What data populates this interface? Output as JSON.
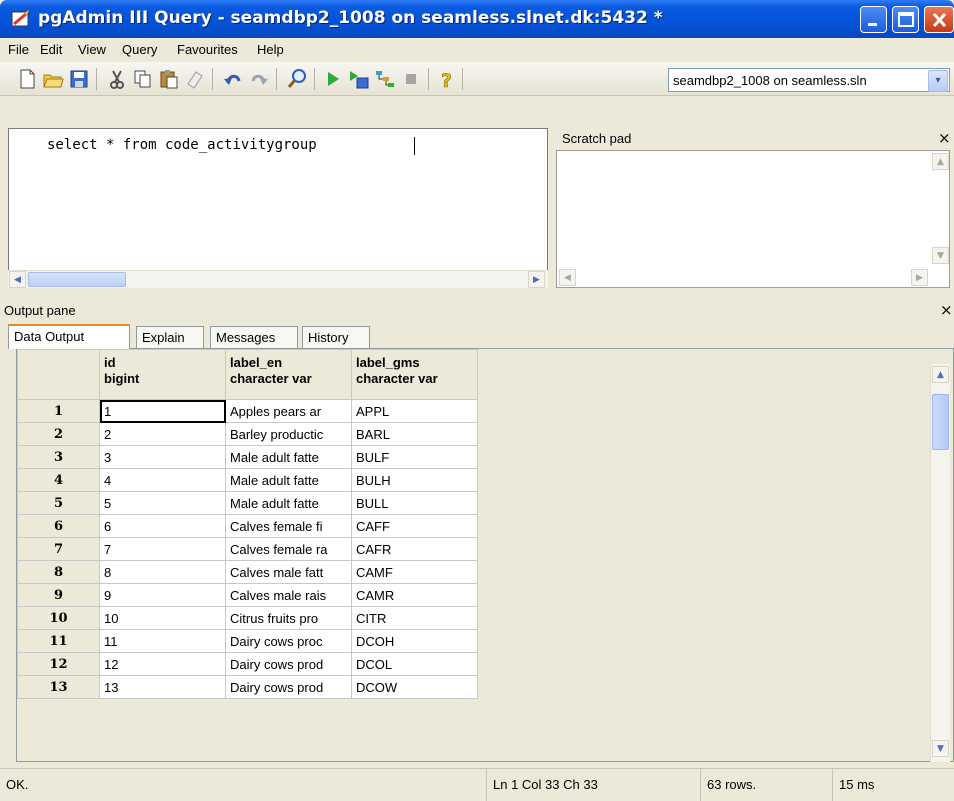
{
  "window": {
    "title": "pgAdmin III Query - seamdbp2_1008 on seamless.slnet.dk:5432 *"
  },
  "menu": [
    "File",
    "Edit",
    "View",
    "Query",
    "Favourites",
    "Help"
  ],
  "toolbar": {
    "icons": [
      "new-file-icon",
      "open-folder-icon",
      "save-icon",
      "cut-icon",
      "copy-icon",
      "paste-icon",
      "clear-icon",
      "undo-icon",
      "redo-icon",
      "find-icon",
      "execute-icon",
      "execute-to-file-icon",
      "explain-icon",
      "stop-icon",
      "help-icon"
    ],
    "connection_value": "seamdbp2_1008 on seamless.sln",
    "dropdown_glyph": "▾"
  },
  "editor": {
    "query": "select * from code_activitygroup"
  },
  "scratch_pad": {
    "title": "Scratch pad",
    "close": "×"
  },
  "output_pane": {
    "title": "Output pane",
    "close": "×",
    "tabs": [
      "Data Output",
      "Explain",
      "Messages",
      "History"
    ],
    "active_tab": "Data Output",
    "columns": [
      {
        "name": "id",
        "type": "bigint"
      },
      {
        "name": "label_en",
        "type": "character var"
      },
      {
        "name": "label_gms",
        "type": "character var"
      }
    ],
    "rows": [
      {
        "n": "1",
        "id": "1",
        "label_en": "Apples  pears ar",
        "label_gms": "APPL"
      },
      {
        "n": "2",
        "id": "2",
        "label_en": "Barley productic",
        "label_gms": "BARL"
      },
      {
        "n": "3",
        "id": "3",
        "label_en": "Male adult fatte",
        "label_gms": "BULF"
      },
      {
        "n": "4",
        "id": "4",
        "label_en": "Male adult fatte",
        "label_gms": "BULH"
      },
      {
        "n": "5",
        "id": "5",
        "label_en": "Male adult fatte",
        "label_gms": "BULL"
      },
      {
        "n": "6",
        "id": "6",
        "label_en": "Calves female fi",
        "label_gms": "CAFF"
      },
      {
        "n": "7",
        "id": "7",
        "label_en": "Calves female ra",
        "label_gms": "CAFR"
      },
      {
        "n": "8",
        "id": "8",
        "label_en": "Calves male fatt",
        "label_gms": "CAMF"
      },
      {
        "n": "9",
        "id": "9",
        "label_en": "Calves male rais",
        "label_gms": "CAMR"
      },
      {
        "n": "10",
        "id": "10",
        "label_en": "Citrus fruits pro",
        "label_gms": "CITR"
      },
      {
        "n": "11",
        "id": "11",
        "label_en": "Dairy cows  proc",
        "label_gms": "DCOH"
      },
      {
        "n": "12",
        "id": "12",
        "label_en": "Dairy cows prod",
        "label_gms": "DCOL"
      },
      {
        "n": "13",
        "id": "13",
        "label_en": "Dairy cows prod",
        "label_gms": "DCOW"
      }
    ]
  },
  "status": {
    "message": "OK.",
    "position": "Ln 1 Col 33 Ch 33",
    "rows": "63 rows.",
    "time": "15 ms"
  }
}
